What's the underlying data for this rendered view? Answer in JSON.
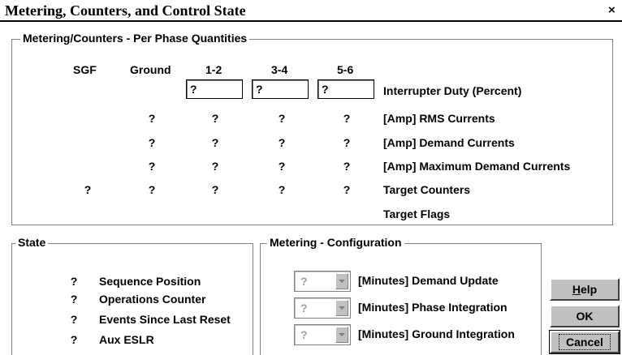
{
  "window": {
    "title": "Metering, Counters, and Control State",
    "close_glyph": "×"
  },
  "metering_group": {
    "title": "Metering/Counters - Per Phase Quantities",
    "columns": [
      "SGF",
      "Ground",
      "1-2",
      "3-4",
      "5-6"
    ],
    "duty_row": {
      "values": [
        "?",
        "?",
        "?"
      ],
      "label": "Interrupter Duty (Percent)"
    },
    "rows": [
      {
        "values": [
          "",
          "?",
          "?",
          "?",
          "?"
        ],
        "label": "[Amp] RMS Currents"
      },
      {
        "values": [
          "",
          "?",
          "?",
          "?",
          "?"
        ],
        "label": "[Amp] Demand Currents"
      },
      {
        "values": [
          "",
          "?",
          "?",
          "?",
          "?"
        ],
        "label": "[Amp] Maximum Demand Currents"
      },
      {
        "values": [
          "?",
          "?",
          "?",
          "?",
          "?"
        ],
        "label": "Target Counters"
      },
      {
        "values": [
          "",
          "",
          "",
          "",
          ""
        ],
        "label": "Target Flags"
      }
    ]
  },
  "state_group": {
    "title": "State",
    "items": [
      {
        "value": "?",
        "label": "Sequence Position"
      },
      {
        "value": "?",
        "label": "Operations Counter"
      },
      {
        "value": "?",
        "label": "Events Since Last Reset"
      },
      {
        "value": "?",
        "label": "Aux ESLR"
      }
    ]
  },
  "config_group": {
    "title": "Metering - Configuration",
    "items": [
      {
        "value": "?",
        "label": "[Minutes] Demand Update"
      },
      {
        "value": "?",
        "label": "[Minutes] Phase Integration"
      },
      {
        "value": "?",
        "label": "[Minutes] Ground Integration"
      }
    ]
  },
  "buttons": {
    "help_mnemonic": "H",
    "help_rest": "elp",
    "ok": "OK",
    "cancel": "Cancel"
  }
}
